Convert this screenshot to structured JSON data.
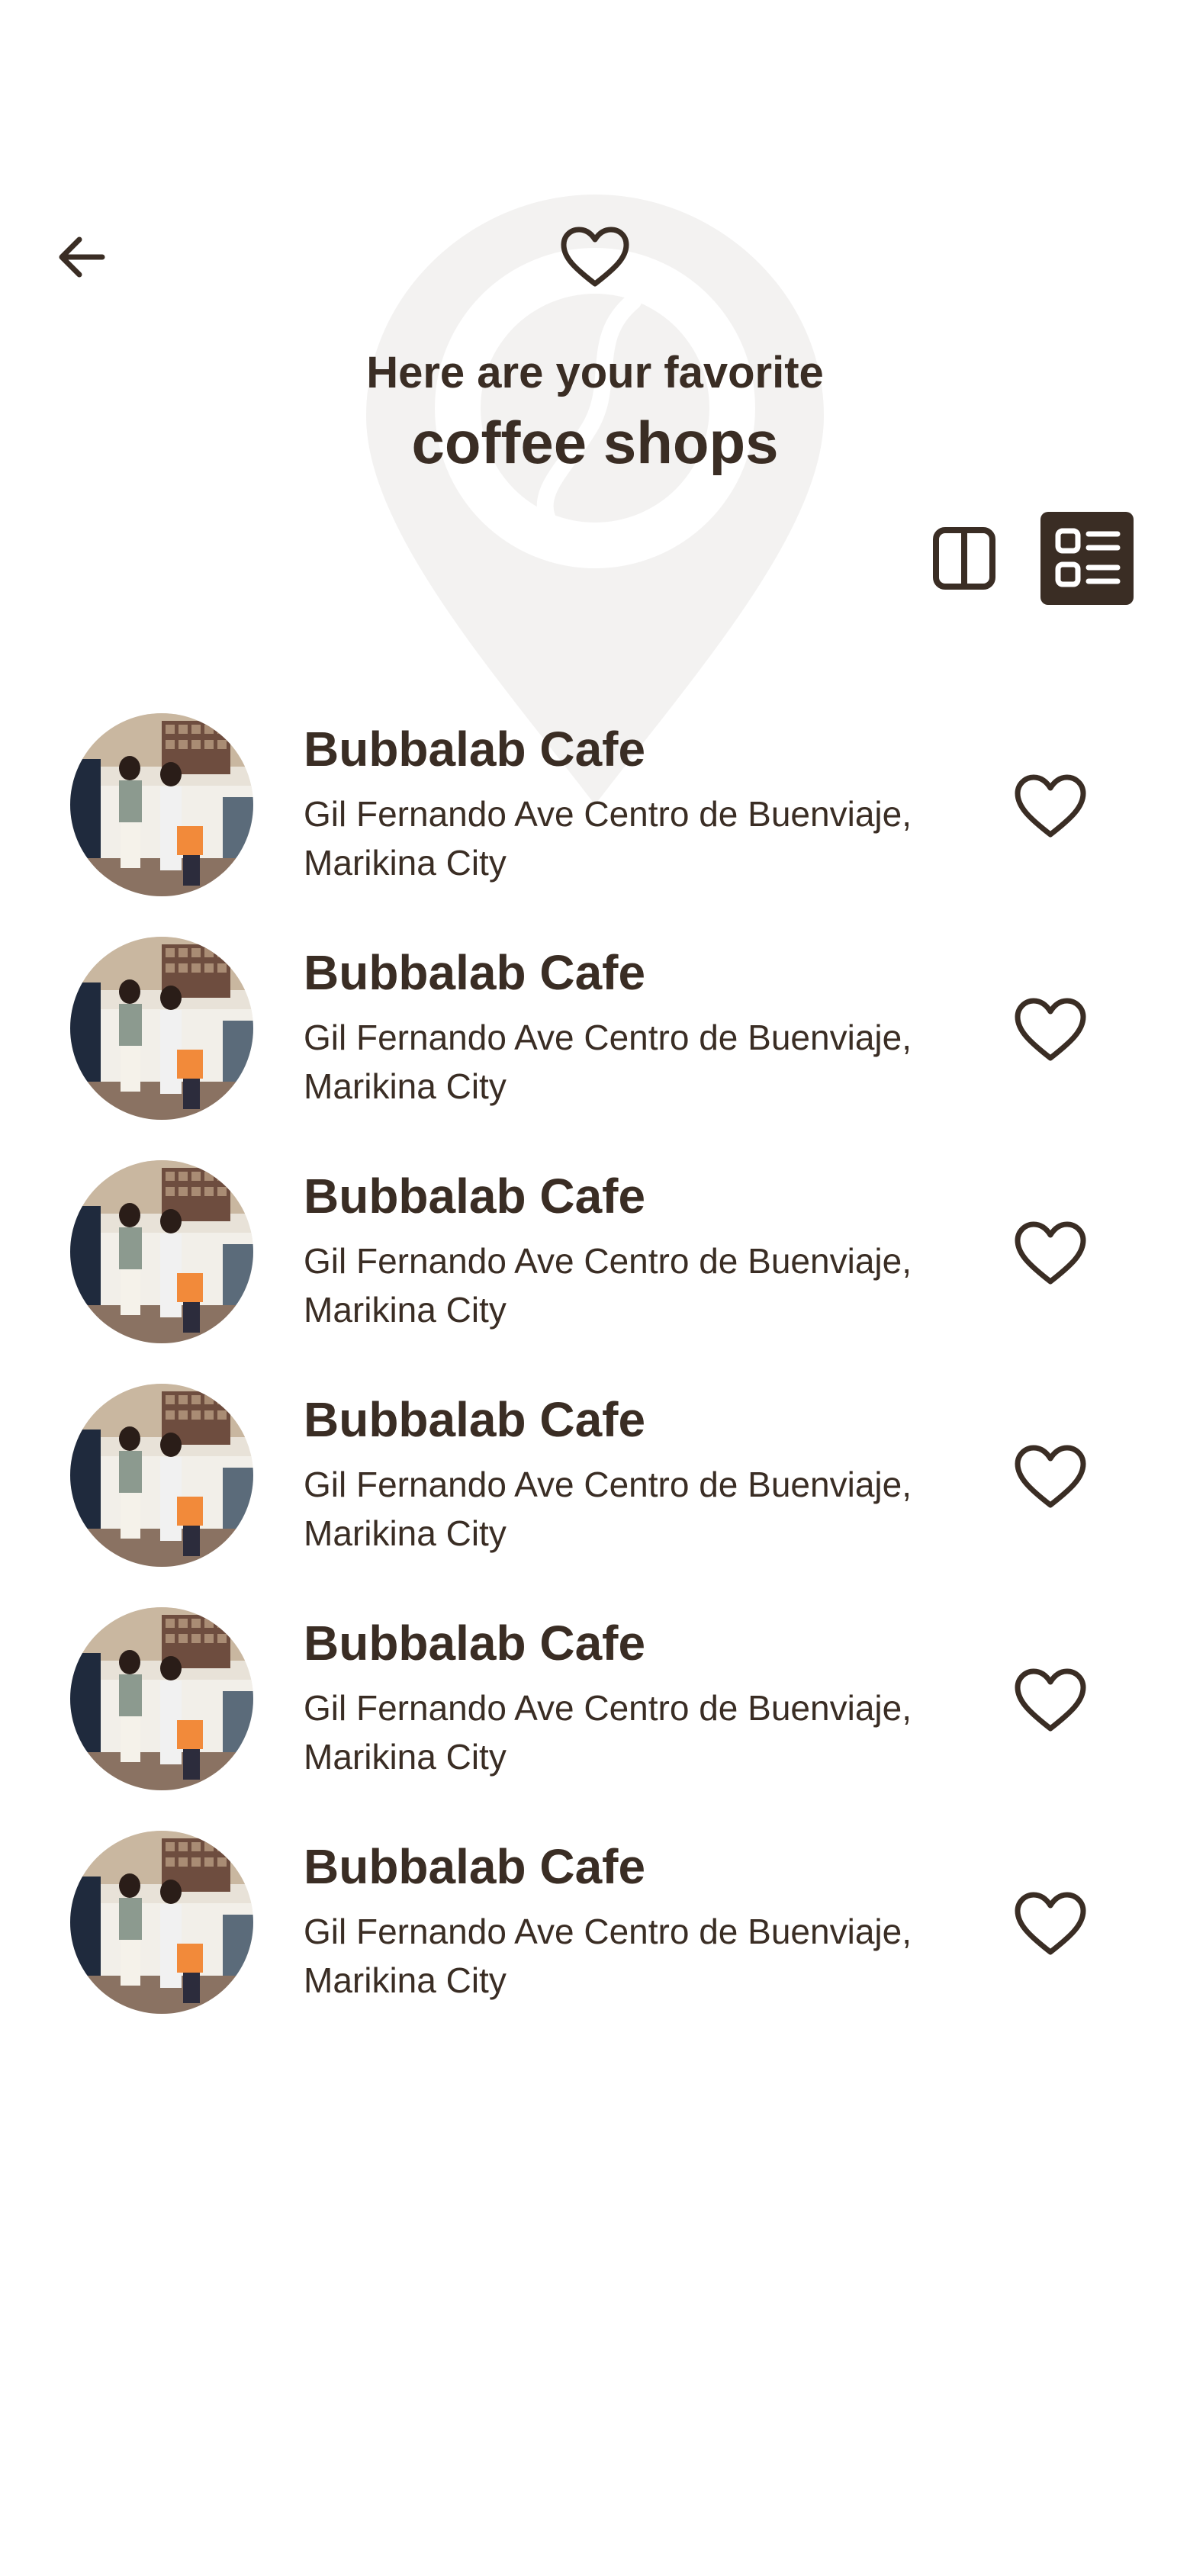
{
  "header": {
    "back_icon": "arrow-left-icon",
    "favorites_icon": "heart-outline-icon",
    "title_line1": "Here are your favorite",
    "title_line2": "coffee shops"
  },
  "view_toggle": {
    "grid_icon": "two-column-icon",
    "list_icon": "list-view-icon",
    "active": "list"
  },
  "shops": [
    {
      "name": "Bubbalab Cafe",
      "address": "Gil Fernando Ave Centro de Buenviaje, Marikina City",
      "favorite_icon": "heart-outline-icon"
    },
    {
      "name": "Bubbalab Cafe",
      "address": "Gil Fernando Ave Centro de Buenviaje, Marikina City",
      "favorite_icon": "heart-outline-icon"
    },
    {
      "name": "Bubbalab Cafe",
      "address": "Gil Fernando Ave Centro de Buenviaje, Marikina City",
      "favorite_icon": "heart-outline-icon"
    },
    {
      "name": "Bubbalab Cafe",
      "address": "Gil Fernando Ave Centro de Buenviaje, Marikina City",
      "favorite_icon": "heart-outline-icon"
    },
    {
      "name": "Bubbalab Cafe",
      "address": "Gil Fernando Ave Centro de Buenviaje, Marikina City",
      "favorite_icon": "heart-outline-icon"
    },
    {
      "name": "Bubbalab Cafe",
      "address": "Gil Fernando Ave Centro de Buenviaje, Marikina City",
      "favorite_icon": "heart-outline-icon"
    }
  ],
  "colors": {
    "primary": "#3a2d24",
    "background": "#ffffff",
    "watermark": "#f3f2f1"
  }
}
